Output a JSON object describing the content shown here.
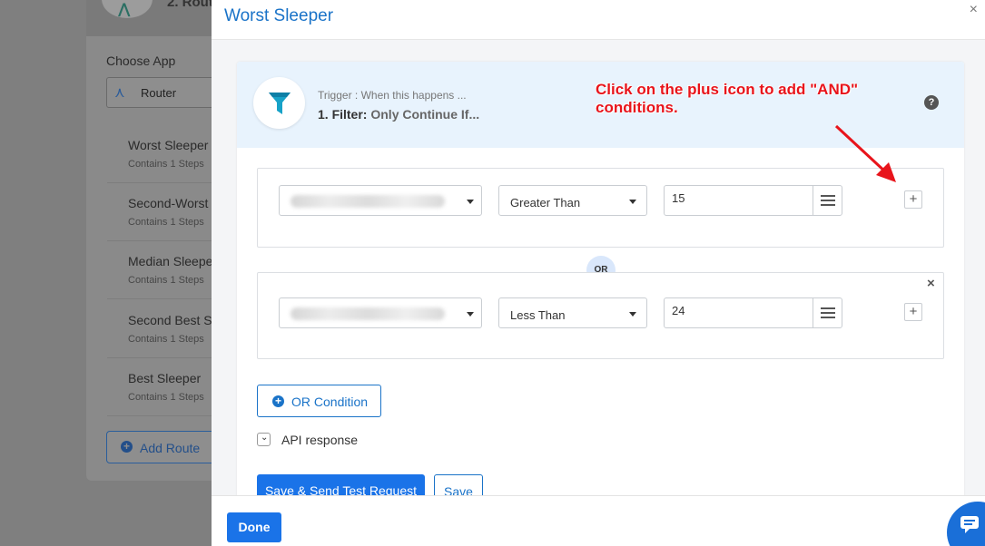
{
  "background": {
    "header_label": "2. Rout",
    "choose_app_label": "Choose App",
    "app_select_value": "Router",
    "routes": [
      {
        "name": "Worst Sleeper",
        "sub": "Contains 1 Steps"
      },
      {
        "name": "Second-Worst S",
        "sub": "Contains 1 Steps"
      },
      {
        "name": "Median Sleepe",
        "sub": "Contains 1 Steps"
      },
      {
        "name": "Second Best Sl",
        "sub": "Contains 1 Steps"
      },
      {
        "name": "Best Sleeper",
        "sub": "Contains 1 Steps"
      }
    ],
    "add_route_label": "Add Route"
  },
  "modal": {
    "title": "Worst Sleeper",
    "close_glyph": "×",
    "trigger_sub": "Trigger : When this happens ...",
    "trigger_step": "1. Filter:",
    "trigger_desc": "Only Continue If...",
    "annotation_line1": "Click on the plus icon to add \"AND\"",
    "annotation_line2": "conditions.",
    "help_glyph": "?",
    "conditions": [
      {
        "operator": "Greater Than",
        "value": "15"
      },
      {
        "operator": "Less Than",
        "value": "24"
      }
    ],
    "or_badge": "OR",
    "or_condition_label": "OR Condition",
    "api_response_label": "API response",
    "save_send_label": "Save & Send Test Request",
    "save_label": "Save",
    "done_label": "Done"
  },
  "colors": {
    "accent": "#1a73e8",
    "annotation": "#e8141b",
    "header_bg": "#e8f3fd"
  }
}
